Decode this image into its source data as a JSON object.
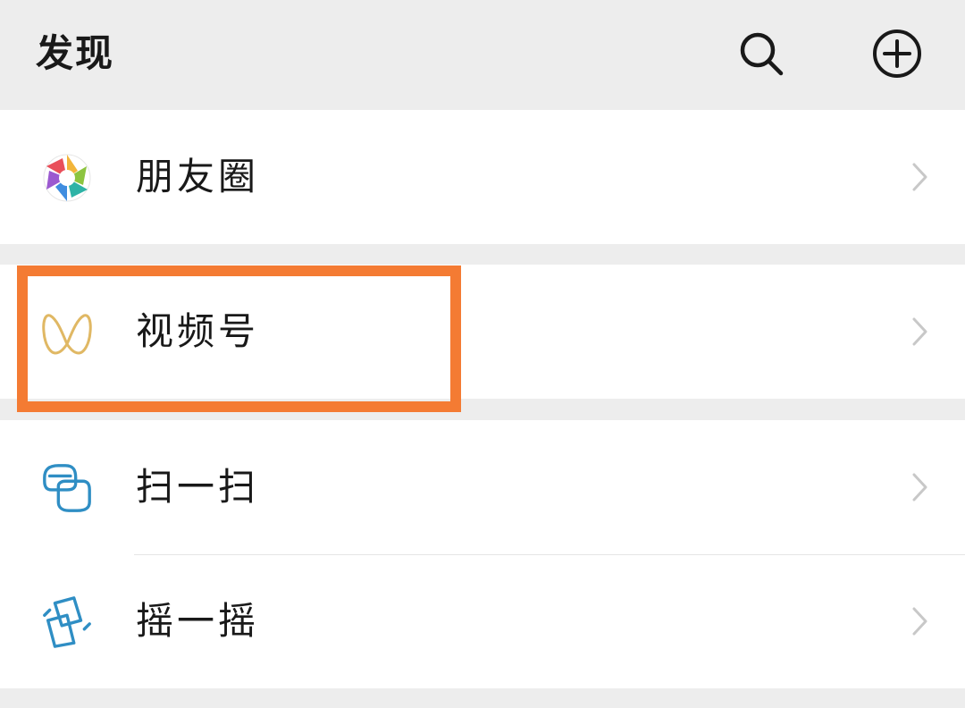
{
  "header": {
    "title": "发现",
    "search_icon": "search-icon",
    "add_icon": "plus-circle-icon"
  },
  "menu": [
    {
      "label": "朋友圈",
      "icon": "moments-aperture-icon"
    },
    {
      "label": "视频号",
      "icon": "channels-butterfly-icon"
    },
    {
      "label": "扫一扫",
      "icon": "scan-icon"
    },
    {
      "label": "摇一摇",
      "icon": "shake-icon"
    }
  ],
  "highlight": {
    "target": "视频号",
    "color": "#f47b33"
  },
  "colors": {
    "background": "#ededed",
    "row_background": "#ffffff",
    "channels_gold": "#e0b864",
    "scan_teal": "#2f8ec4",
    "chevron": "#c8c8c8"
  }
}
